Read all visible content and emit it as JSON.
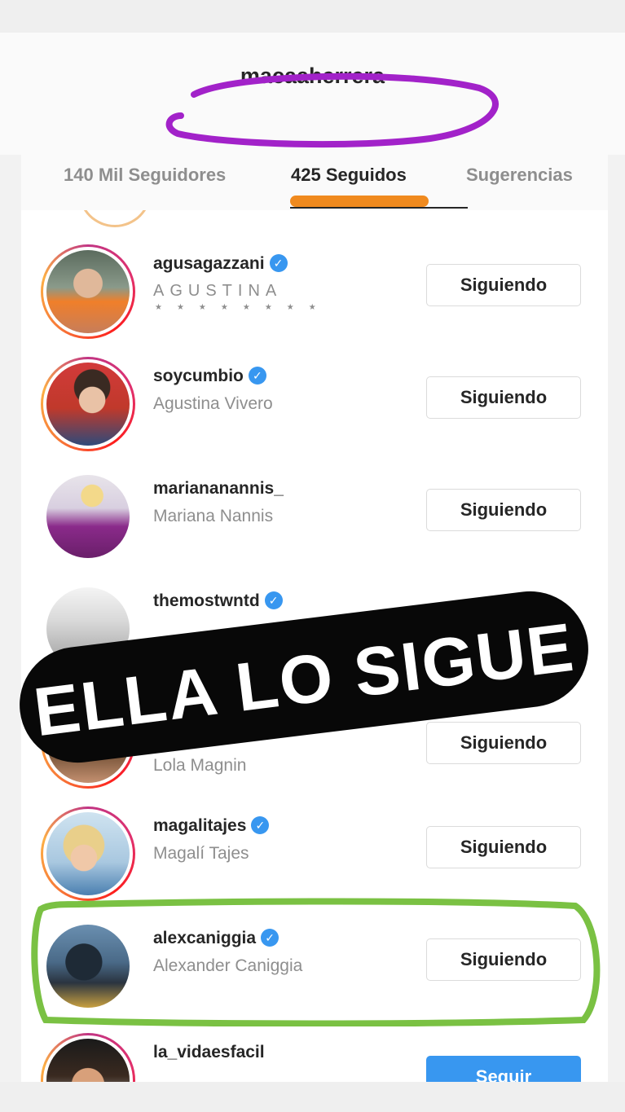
{
  "header": {
    "title": "macaaherrera"
  },
  "tabs": [
    {
      "label": "140 Mil Seguidores",
      "active": false
    },
    {
      "label": "425 Seguidos",
      "active": true
    },
    {
      "label": "Sugerencias",
      "active": false
    }
  ],
  "accounts": [
    {
      "username": "agusagazzani",
      "verified": true,
      "full_name": "AGUSTINA",
      "button": "Siguiendo"
    },
    {
      "username": "soycumbio",
      "verified": true,
      "full_name": "Agustina Vivero",
      "button": "Siguiendo"
    },
    {
      "username": "mariananannis_",
      "verified": false,
      "full_name": "Mariana Nannis",
      "button": "Siguiendo"
    },
    {
      "username": "themostwntd",
      "verified": true,
      "full_name": "",
      "button": ""
    },
    {
      "username": "",
      "verified": false,
      "full_name": "Lola Magnin",
      "button": "Siguiendo"
    },
    {
      "username": "magalitajes",
      "verified": true,
      "full_name": "Magalí Tajes",
      "button": "Siguiendo"
    },
    {
      "username": "alexcaniggia",
      "verified": true,
      "full_name": "Alexander Caniggia",
      "button": "Siguiendo"
    },
    {
      "username": "la_vidaesfacil",
      "verified": false,
      "full_name": "",
      "button": "Seguir"
    }
  ],
  "overlay": {
    "text": "ELLA LO SIGUE"
  },
  "colors": {
    "verified_blue": "#3897f0",
    "purple_highlight": "#a222c9",
    "orange_highlight": "#f08a1e",
    "green_highlight": "#7ac143",
    "banner_bg": "#080808"
  },
  "icons": {
    "verified": "check-badge"
  }
}
